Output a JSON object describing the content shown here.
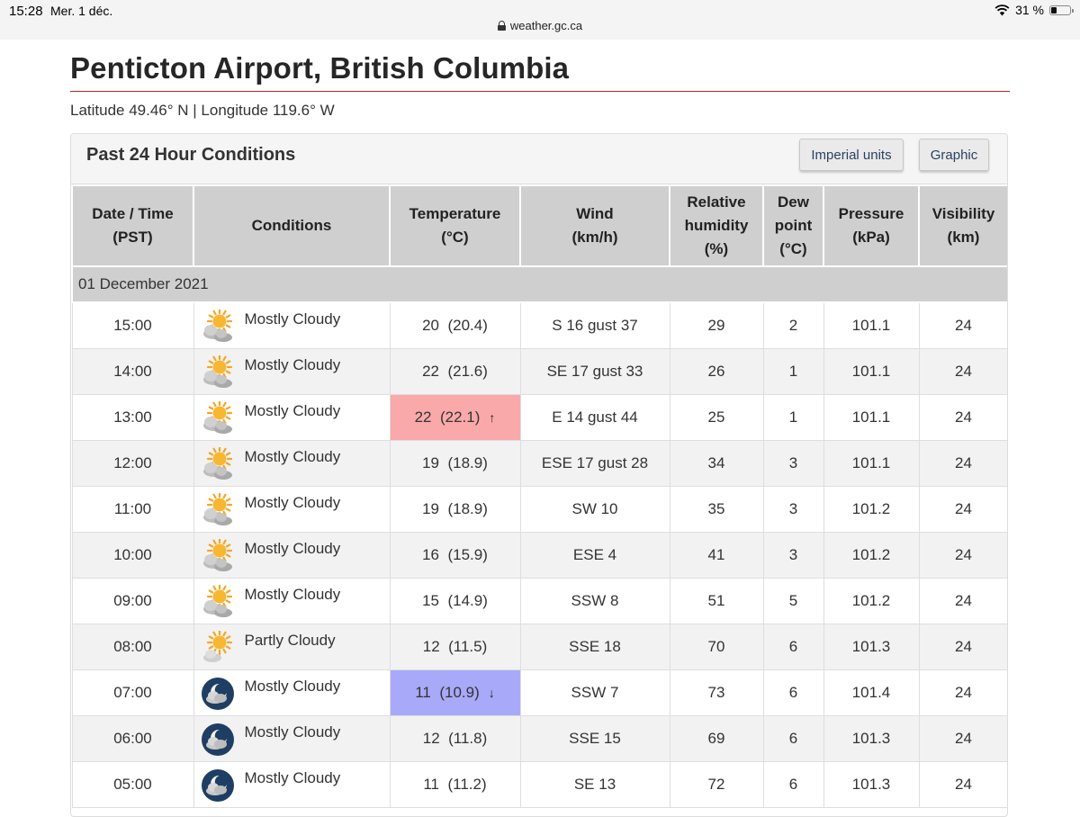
{
  "status_bar": {
    "time": "15:28",
    "date": "Mer. 1 déc.",
    "battery": "31 %",
    "battery_level": 0.31,
    "wifi_icon": "wifi-icon"
  },
  "browser": {
    "url": "weather.gc.ca"
  },
  "page": {
    "title": "Penticton Airport, British Columbia",
    "coordinates": "Latitude 49.46° N | Longitude 119.6° W"
  },
  "panel": {
    "title": "Past 24 Hour Conditions",
    "imperial_button": "Imperial units",
    "graphic_button": "Graphic"
  },
  "colors": {
    "title_rule": "#a3262a",
    "max_temp": "#f9a9a9",
    "min_temp": "#a9a9f9",
    "button_text": "#284162"
  },
  "table": {
    "headers": [
      [
        "Date / Time",
        "(PST)"
      ],
      [
        "Conditions"
      ],
      [
        "Temperature",
        "(°C)"
      ],
      [
        "Wind",
        "(km/h)"
      ],
      [
        "Relative",
        "humidity",
        "(%)"
      ],
      [
        "Dew",
        "point",
        "(°C)"
      ],
      [
        "Pressure",
        "(kPa)"
      ],
      [
        "Visibility",
        "(km)"
      ]
    ],
    "date_label": "01 December 2021",
    "rows": [
      {
        "time": "15:00",
        "icon": "day-mostly-cloudy",
        "condition": "Mostly Cloudy",
        "temp": "20",
        "temp_detail": "(20.4)",
        "wind": "S 16 gust 37",
        "humidity": "29",
        "dew": "2",
        "pressure": "101.1",
        "visibility": "24"
      },
      {
        "time": "14:00",
        "icon": "day-mostly-cloudy",
        "condition": "Mostly Cloudy",
        "temp": "22",
        "temp_detail": "(21.6)",
        "wind": "SE 17 gust 33",
        "humidity": "26",
        "dew": "1",
        "pressure": "101.1",
        "visibility": "24"
      },
      {
        "time": "13:00",
        "icon": "day-mostly-cloudy",
        "condition": "Mostly Cloudy",
        "temp": "22",
        "temp_detail": "(22.1)",
        "temp_flag": "max",
        "trend_icon": "arrow-up",
        "wind": "E 14 gust 44",
        "humidity": "25",
        "dew": "1",
        "pressure": "101.1",
        "visibility": "24"
      },
      {
        "time": "12:00",
        "icon": "day-mostly-cloudy",
        "condition": "Mostly Cloudy",
        "temp": "19",
        "temp_detail": "(18.9)",
        "wind": "ESE 17 gust 28",
        "humidity": "34",
        "dew": "3",
        "pressure": "101.1",
        "visibility": "24"
      },
      {
        "time": "11:00",
        "icon": "day-mostly-cloudy",
        "condition": "Mostly Cloudy",
        "temp": "19",
        "temp_detail": "(18.9)",
        "wind": "SW 10",
        "humidity": "35",
        "dew": "3",
        "pressure": "101.2",
        "visibility": "24"
      },
      {
        "time": "10:00",
        "icon": "day-mostly-cloudy",
        "condition": "Mostly Cloudy",
        "temp": "16",
        "temp_detail": "(15.9)",
        "wind": "ESE 4",
        "humidity": "41",
        "dew": "3",
        "pressure": "101.2",
        "visibility": "24"
      },
      {
        "time": "09:00",
        "icon": "day-mostly-cloudy",
        "condition": "Mostly Cloudy",
        "temp": "15",
        "temp_detail": "(14.9)",
        "wind": "SSW 8",
        "humidity": "51",
        "dew": "5",
        "pressure": "101.2",
        "visibility": "24"
      },
      {
        "time": "08:00",
        "icon": "day-partly-cloudy",
        "condition": "Partly Cloudy",
        "temp": "12",
        "temp_detail": "(11.5)",
        "wind": "SSE 18",
        "humidity": "70",
        "dew": "6",
        "pressure": "101.3",
        "visibility": "24"
      },
      {
        "time": "07:00",
        "icon": "night-mostly-cloudy",
        "condition": "Mostly Cloudy",
        "temp": "11",
        "temp_detail": "(10.9)",
        "temp_flag": "min",
        "trend_icon": "arrow-down",
        "wind": "SSW 7",
        "humidity": "73",
        "dew": "6",
        "pressure": "101.4",
        "visibility": "24"
      },
      {
        "time": "06:00",
        "icon": "night-mostly-cloudy",
        "condition": "Mostly Cloudy",
        "temp": "12",
        "temp_detail": "(11.8)",
        "wind": "SSE 15",
        "humidity": "69",
        "dew": "6",
        "pressure": "101.3",
        "visibility": "24"
      },
      {
        "time": "05:00",
        "icon": "night-mostly-cloudy",
        "condition": "Mostly Cloudy",
        "temp": "11",
        "temp_detail": "(11.2)",
        "wind": "SE 13",
        "humidity": "72",
        "dew": "6",
        "pressure": "101.3",
        "visibility": "24"
      }
    ]
  }
}
